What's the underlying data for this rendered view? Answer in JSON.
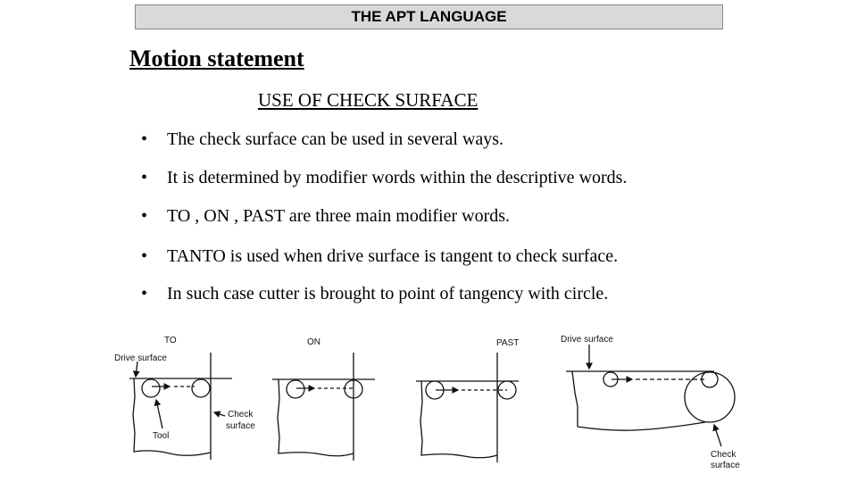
{
  "header": {
    "title": "THE APT LANGUAGE"
  },
  "heading": "Motion statement",
  "subheading": "USE OF CHECK SURFACE",
  "bullets": [
    "The check surface can be used in several ways.",
    "It is determined by modifier words within the descriptive words.",
    "TO , ON , PAST are three main modifier words.",
    "TANTO is used when drive surface is tangent to check surface.",
    "In such case cutter is brought to point of tangency with circle."
  ],
  "bullet_glyph": "•",
  "diagrams": {
    "to": {
      "label": "TO",
      "drive_surface": "Drive surface",
      "check_line1": "Check",
      "check_line2": "surface",
      "tool": "Tool"
    },
    "on": {
      "label": "ON"
    },
    "past": {
      "label": "PAST"
    },
    "tanto": {
      "drive_surface": "Drive surface",
      "check_line1": "Check",
      "check_line2": "surface"
    }
  }
}
